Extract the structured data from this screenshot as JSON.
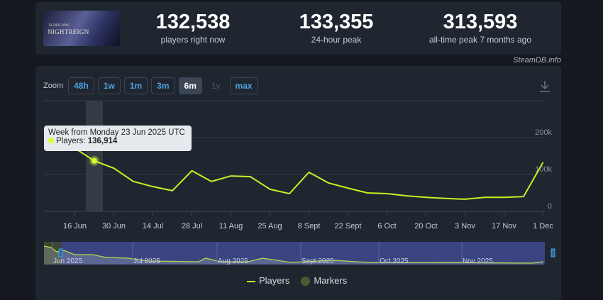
{
  "game": {
    "logo_small": "ELDEN RING",
    "logo_title": "NIGHTREIGN"
  },
  "stats": [
    {
      "value": "132,538",
      "label": "players right now"
    },
    {
      "value": "133,355",
      "label": "24-hour peak"
    },
    {
      "value": "313,593",
      "label": "all-time peak 7 months ago"
    }
  ],
  "credit": "SteamDB.info",
  "zoom": {
    "label": "Zoom",
    "buttons": [
      {
        "label": "48h",
        "state": "normal"
      },
      {
        "label": "1w",
        "state": "normal"
      },
      {
        "label": "1m",
        "state": "normal"
      },
      {
        "label": "3m",
        "state": "normal"
      },
      {
        "label": "6m",
        "state": "active"
      },
      {
        "label": "1y",
        "state": "disabled"
      },
      {
        "label": "max",
        "state": "normal"
      }
    ]
  },
  "download_icon": "download-icon",
  "tooltip": {
    "title": "Week from Monday 23 Jun 2025 UTC",
    "series": "Players: ",
    "value": "136,914"
  },
  "colors": {
    "line": "#c8f024",
    "accent": "#4ba3e3",
    "navigator": "#3a4480"
  },
  "chart_data": {
    "type": "line",
    "x": [
      "9 Jun",
      "16 Jun",
      "23 Jun",
      "30 Jun",
      "7 Jul",
      "14 Jul",
      "21 Jul",
      "28 Jul",
      "4 Aug",
      "11 Aug",
      "18 Aug",
      "25 Aug",
      "1 Sept",
      "8 Sept",
      "15 Sept",
      "22 Sept",
      "29 Sept",
      "6 Oct",
      "13 Oct",
      "20 Oct",
      "27 Oct",
      "3 Nov",
      "10 Nov",
      "17 Nov",
      "24 Nov",
      "1 Dec"
    ],
    "series": [
      {
        "name": "Players",
        "values": [
          205000,
          171000,
          136914,
          117000,
          81000,
          67000,
          56000,
          110000,
          81000,
          96000,
          94000,
          60000,
          48000,
          106000,
          77000,
          63000,
          50000,
          48000,
          42000,
          38000,
          35000,
          33000,
          38000,
          38000,
          40000,
          133000
        ]
      }
    ],
    "xticks": [
      "16 Jun",
      "30 Jun",
      "14 Jul",
      "28 Jul",
      "11 Aug",
      "25 Aug",
      "8 Sept",
      "22 Sept",
      "6 Oct",
      "20 Oct",
      "3 Nov",
      "17 Nov",
      "1 Dec"
    ],
    "yticks": [
      "0",
      "100k",
      "200k"
    ],
    "ylim": [
      0,
      300000
    ],
    "grid": true,
    "highlighted": "23 Jun",
    "navigator_labels": [
      "Jun 2025",
      "Jul 2025",
      "Aug 2025",
      "Sept 2025",
      "Oct 2025",
      "Nov 2025"
    ],
    "legend": [
      "Players",
      "Markers"
    ],
    "legend_position": "bottom"
  }
}
